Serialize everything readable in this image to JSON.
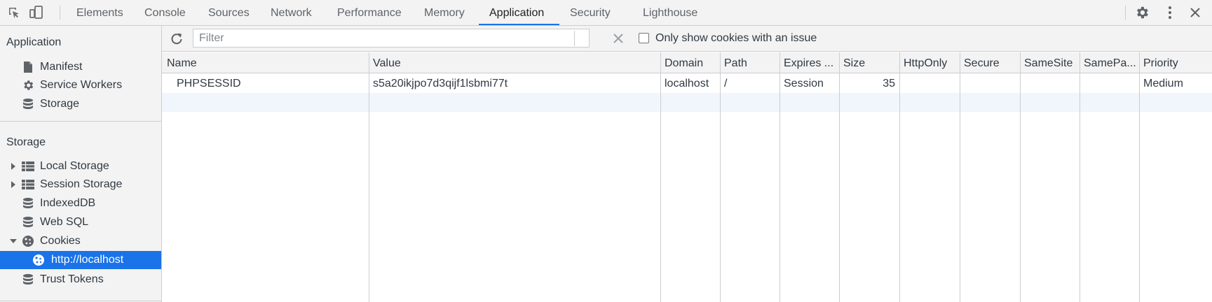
{
  "tabs": [
    {
      "label": "Elements"
    },
    {
      "label": "Console"
    },
    {
      "label": "Sources"
    },
    {
      "label": "Network"
    },
    {
      "label": "Performance"
    },
    {
      "label": "Memory"
    },
    {
      "label": "Application"
    },
    {
      "label": "Security"
    },
    {
      "label": "Lighthouse"
    }
  ],
  "active_tab": "Application",
  "sidebar": {
    "application_heading": "Application",
    "application_items": [
      {
        "label": "Manifest",
        "icon": "document-icon"
      },
      {
        "label": "Service Workers",
        "icon": "gear-icon"
      },
      {
        "label": "Storage",
        "icon": "database-icon"
      }
    ],
    "storage_heading": "Storage",
    "storage_items": [
      {
        "label": "Local Storage",
        "icon": "table-icon",
        "expandable": true
      },
      {
        "label": "Session Storage",
        "icon": "table-icon",
        "expandable": true
      },
      {
        "label": "IndexedDB",
        "icon": "database-icon"
      },
      {
        "label": "Web SQL",
        "icon": "database-icon"
      },
      {
        "label": "Cookies",
        "icon": "cookie-icon",
        "expanded": true
      },
      {
        "label": "http://localhost",
        "icon": "cookie-icon",
        "selected": true
      },
      {
        "label": "Trust Tokens",
        "icon": "database-icon"
      }
    ]
  },
  "toolbar": {
    "filter_placeholder": "Filter",
    "filter_value": "",
    "only_issues_label": "Only show cookies with an issue",
    "only_issues_checked": false
  },
  "table": {
    "columns": [
      "Name",
      "Value",
      "Domain",
      "Path",
      "Expires ...",
      "Size",
      "HttpOnly",
      "Secure",
      "SameSite",
      "SamePa...",
      "Priority"
    ],
    "rows": [
      {
        "name": "PHPSESSID",
        "value": "s5a20ikjpo7d3qijf1lsbmi77t",
        "domain": "localhost",
        "path": "/",
        "expires": "Session",
        "size": "35",
        "httponly": "",
        "secure": "",
        "samesite": "",
        "sameparty": "",
        "priority": "Medium"
      }
    ]
  },
  "colors": {
    "accent": "#1a73e8",
    "panel_bg": "#f3f3f3",
    "border": "#cbcdd1",
    "selected_row_bg": "#f1f5fc"
  }
}
